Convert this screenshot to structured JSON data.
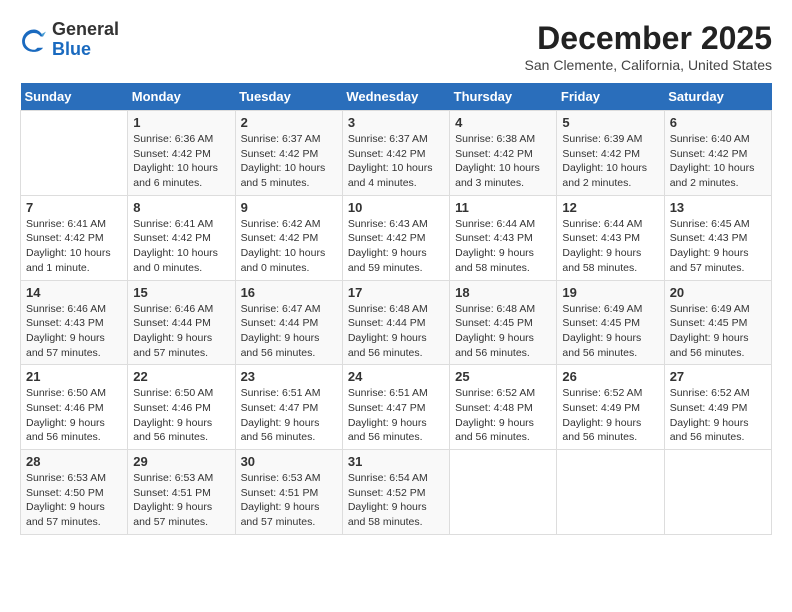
{
  "logo": {
    "general": "General",
    "blue": "Blue"
  },
  "title": "December 2025",
  "subtitle": "San Clemente, California, United States",
  "days_header": [
    "Sunday",
    "Monday",
    "Tuesday",
    "Wednesday",
    "Thursday",
    "Friday",
    "Saturday"
  ],
  "weeks": [
    [
      {
        "day": "",
        "content": ""
      },
      {
        "day": "1",
        "content": "Sunrise: 6:36 AM\nSunset: 4:42 PM\nDaylight: 10 hours\nand 6 minutes."
      },
      {
        "day": "2",
        "content": "Sunrise: 6:37 AM\nSunset: 4:42 PM\nDaylight: 10 hours\nand 5 minutes."
      },
      {
        "day": "3",
        "content": "Sunrise: 6:37 AM\nSunset: 4:42 PM\nDaylight: 10 hours\nand 4 minutes."
      },
      {
        "day": "4",
        "content": "Sunrise: 6:38 AM\nSunset: 4:42 PM\nDaylight: 10 hours\nand 3 minutes."
      },
      {
        "day": "5",
        "content": "Sunrise: 6:39 AM\nSunset: 4:42 PM\nDaylight: 10 hours\nand 2 minutes."
      },
      {
        "day": "6",
        "content": "Sunrise: 6:40 AM\nSunset: 4:42 PM\nDaylight: 10 hours\nand 2 minutes."
      }
    ],
    [
      {
        "day": "7",
        "content": "Sunrise: 6:41 AM\nSunset: 4:42 PM\nDaylight: 10 hours\nand 1 minute."
      },
      {
        "day": "8",
        "content": "Sunrise: 6:41 AM\nSunset: 4:42 PM\nDaylight: 10 hours\nand 0 minutes."
      },
      {
        "day": "9",
        "content": "Sunrise: 6:42 AM\nSunset: 4:42 PM\nDaylight: 10 hours\nand 0 minutes."
      },
      {
        "day": "10",
        "content": "Sunrise: 6:43 AM\nSunset: 4:42 PM\nDaylight: 9 hours\nand 59 minutes."
      },
      {
        "day": "11",
        "content": "Sunrise: 6:44 AM\nSunset: 4:43 PM\nDaylight: 9 hours\nand 58 minutes."
      },
      {
        "day": "12",
        "content": "Sunrise: 6:44 AM\nSunset: 4:43 PM\nDaylight: 9 hours\nand 58 minutes."
      },
      {
        "day": "13",
        "content": "Sunrise: 6:45 AM\nSunset: 4:43 PM\nDaylight: 9 hours\nand 57 minutes."
      }
    ],
    [
      {
        "day": "14",
        "content": "Sunrise: 6:46 AM\nSunset: 4:43 PM\nDaylight: 9 hours\nand 57 minutes."
      },
      {
        "day": "15",
        "content": "Sunrise: 6:46 AM\nSunset: 4:44 PM\nDaylight: 9 hours\nand 57 minutes."
      },
      {
        "day": "16",
        "content": "Sunrise: 6:47 AM\nSunset: 4:44 PM\nDaylight: 9 hours\nand 56 minutes."
      },
      {
        "day": "17",
        "content": "Sunrise: 6:48 AM\nSunset: 4:44 PM\nDaylight: 9 hours\nand 56 minutes."
      },
      {
        "day": "18",
        "content": "Sunrise: 6:48 AM\nSunset: 4:45 PM\nDaylight: 9 hours\nand 56 minutes."
      },
      {
        "day": "19",
        "content": "Sunrise: 6:49 AM\nSunset: 4:45 PM\nDaylight: 9 hours\nand 56 minutes."
      },
      {
        "day": "20",
        "content": "Sunrise: 6:49 AM\nSunset: 4:45 PM\nDaylight: 9 hours\nand 56 minutes."
      }
    ],
    [
      {
        "day": "21",
        "content": "Sunrise: 6:50 AM\nSunset: 4:46 PM\nDaylight: 9 hours\nand 56 minutes."
      },
      {
        "day": "22",
        "content": "Sunrise: 6:50 AM\nSunset: 4:46 PM\nDaylight: 9 hours\nand 56 minutes."
      },
      {
        "day": "23",
        "content": "Sunrise: 6:51 AM\nSunset: 4:47 PM\nDaylight: 9 hours\nand 56 minutes."
      },
      {
        "day": "24",
        "content": "Sunrise: 6:51 AM\nSunset: 4:47 PM\nDaylight: 9 hours\nand 56 minutes."
      },
      {
        "day": "25",
        "content": "Sunrise: 6:52 AM\nSunset: 4:48 PM\nDaylight: 9 hours\nand 56 minutes."
      },
      {
        "day": "26",
        "content": "Sunrise: 6:52 AM\nSunset: 4:49 PM\nDaylight: 9 hours\nand 56 minutes."
      },
      {
        "day": "27",
        "content": "Sunrise: 6:52 AM\nSunset: 4:49 PM\nDaylight: 9 hours\nand 56 minutes."
      }
    ],
    [
      {
        "day": "28",
        "content": "Sunrise: 6:53 AM\nSunset: 4:50 PM\nDaylight: 9 hours\nand 57 minutes."
      },
      {
        "day": "29",
        "content": "Sunrise: 6:53 AM\nSunset: 4:51 PM\nDaylight: 9 hours\nand 57 minutes."
      },
      {
        "day": "30",
        "content": "Sunrise: 6:53 AM\nSunset: 4:51 PM\nDaylight: 9 hours\nand 57 minutes."
      },
      {
        "day": "31",
        "content": "Sunrise: 6:54 AM\nSunset: 4:52 PM\nDaylight: 9 hours\nand 58 minutes."
      },
      {
        "day": "",
        "content": ""
      },
      {
        "day": "",
        "content": ""
      },
      {
        "day": "",
        "content": ""
      }
    ]
  ]
}
